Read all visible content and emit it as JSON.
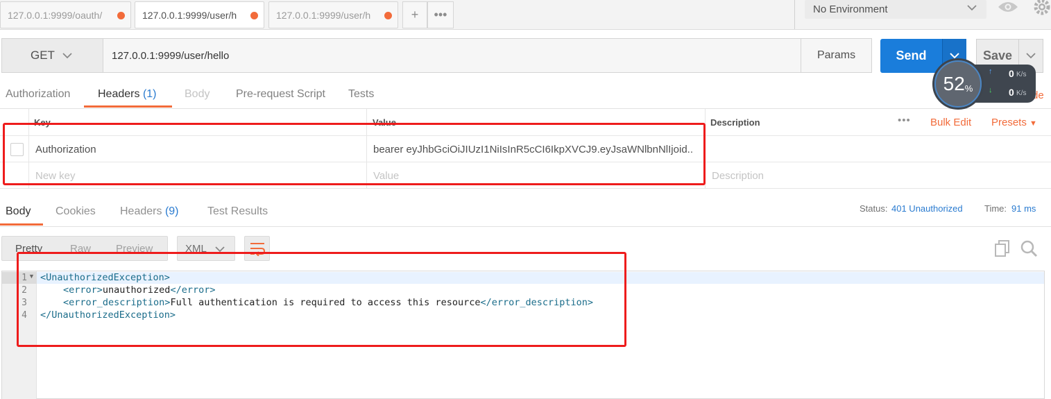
{
  "tabs": [
    {
      "label": "127.0.0.1:9999/oauth/"
    },
    {
      "label": "127.0.0.1:9999/user/h"
    },
    {
      "label": "127.0.0.1:9999/user/h"
    }
  ],
  "environment": {
    "selected": "No Environment"
  },
  "request": {
    "method": "GET",
    "url": "127.0.0.1:9999/user/hello",
    "params_label": "Params",
    "send_label": "Send",
    "save_label": "Save"
  },
  "request_tabs": {
    "authorization": "Authorization",
    "headers": "Headers",
    "headers_count": "(1)",
    "body": "Body",
    "prerequest": "Pre-request Script",
    "tests": "Tests",
    "code": "de"
  },
  "headers_table": {
    "col_key": "Key",
    "col_value": "Value",
    "col_description": "Description",
    "bulk_edit": "Bulk Edit",
    "presets": "Presets",
    "rows": [
      {
        "key": "Authorization",
        "value": "bearer eyJhbGciOiJIUzI1NiIsInR5cCI6IkpXVCJ9.eyJsaWNlbnNlIjoid..."
      }
    ],
    "new_key_placeholder": "New key",
    "value_placeholder": "Value",
    "description_placeholder": "Description"
  },
  "response_tabs": {
    "body": "Body",
    "cookies": "Cookies",
    "headers": "Headers",
    "headers_count": "(9)",
    "test_results": "Test Results"
  },
  "response_meta": {
    "status_label": "Status:",
    "status_value": "401 Unauthorized",
    "time_label": "Time:",
    "time_value": "91 ms"
  },
  "body_view": {
    "pretty": "Pretty",
    "raw": "Raw",
    "preview": "Preview",
    "format": "XML"
  },
  "code_lines": [
    {
      "num": "1",
      "open": "<UnauthorizedException>",
      "text": "",
      "close": ""
    },
    {
      "num": "2",
      "open": "<error>",
      "text": "unauthorized",
      "close": "</error>"
    },
    {
      "num": "3",
      "open": "<error_description>",
      "text": "Full authentication is required to access this resource",
      "close": "</error_description>"
    },
    {
      "num": "4",
      "open": "</UnauthorizedException>",
      "text": "",
      "close": ""
    }
  ],
  "network_widget": {
    "percent": "52",
    "percent_unit": "%",
    "up": "0",
    "down": "0",
    "unit": "K/s"
  },
  "colors": {
    "accent_orange": "#f26b3a",
    "send_blue": "#1a7ddb",
    "link_blue": "#2a7bd0",
    "annotation_red": "#ee1c1c"
  }
}
